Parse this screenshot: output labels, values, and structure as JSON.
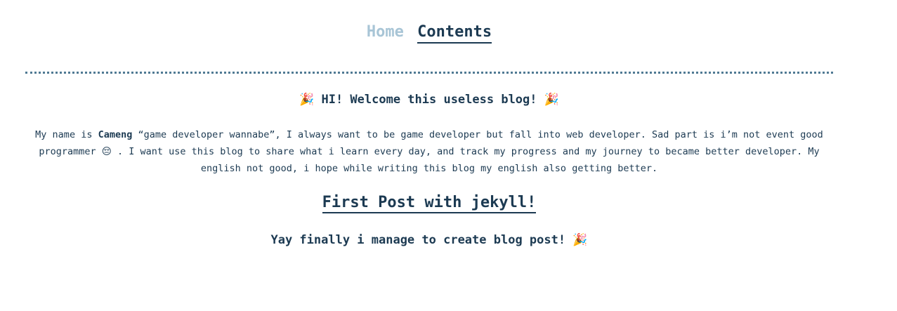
{
  "nav": {
    "home_label": "Home",
    "contents_label": "Contents"
  },
  "welcome": {
    "emoji": "🎉",
    "text": "HI! Welcome this useless blog!"
  },
  "intro": {
    "part1": "My name is ",
    "name": "Cameng",
    "part2": " “game developer wannabe”, I always want to be game developer but fall into web developer. Sad part is i’m not event good programmer ",
    "emoji": "😔",
    "part3": " . I want use this blog to share what i learn every day, and track my progress and my journey to became better developer. My english not good, i hope while writing this blog my english also getting better."
  },
  "post": {
    "title": "First Post with jekyll!",
    "excerpt": "Yay finally i manage to create blog post!",
    "emoji": "🎉"
  }
}
